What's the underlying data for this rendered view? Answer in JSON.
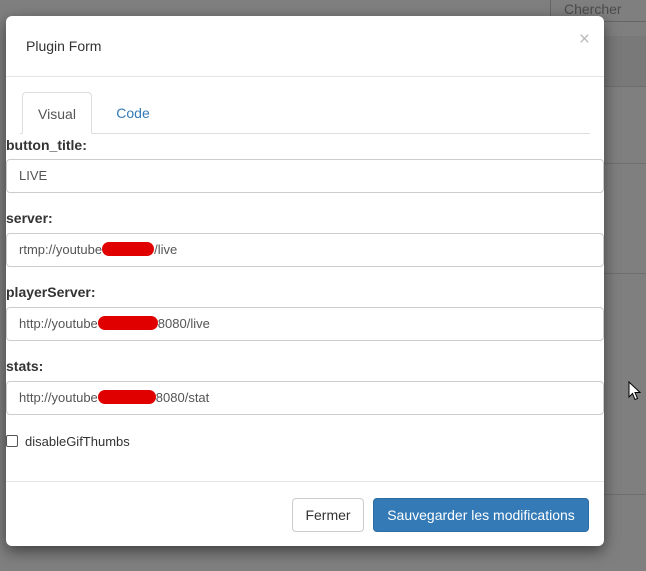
{
  "background": {
    "search_placeholder": "Chercher"
  },
  "modal": {
    "title": "Plugin Form",
    "close_glyph": "×"
  },
  "tabs": [
    {
      "label": "Visual",
      "active": true
    },
    {
      "label": "Code",
      "active": false
    }
  ],
  "fields": {
    "button_title": {
      "label": "button_title:",
      "value": "LIVE"
    },
    "server": {
      "label": "server:",
      "value_prefix": "rtmp://youtube",
      "value_suffix": "/live"
    },
    "player_server": {
      "label": "playerServer:",
      "value_prefix": "http://youtube",
      "value_suffix": "8080/live"
    },
    "stats": {
      "label": "stats:",
      "value_prefix": "http://youtube",
      "value_suffix": "8080/stat"
    }
  },
  "checkbox": {
    "label": "disableGifThumbs",
    "checked": false
  },
  "footer": {
    "close_label": "Fermer",
    "save_label": "Sauvegarder les modifications"
  },
  "colors": {
    "primary": "#337ab7",
    "link": "#337ab7",
    "redaction": "#e00000"
  }
}
